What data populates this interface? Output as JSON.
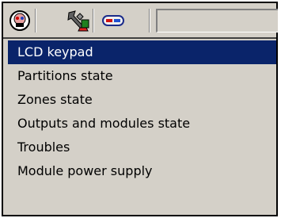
{
  "toolbar": {
    "buttons": [
      {
        "icon": "keypad-face-icon"
      },
      {
        "icon": "tools-icon"
      },
      {
        "icon": "module-icon"
      }
    ],
    "input_value": ""
  },
  "menu": {
    "items": [
      {
        "label": "LCD keypad",
        "selected": true
      },
      {
        "label": "Partitions state"
      },
      {
        "label": "Zones state"
      },
      {
        "label": "Outputs and modules state"
      },
      {
        "label": "Troubles"
      },
      {
        "label": "Module power supply"
      }
    ]
  },
  "colors": {
    "selection": "#0a246a",
    "face": "#d4d0c8"
  }
}
